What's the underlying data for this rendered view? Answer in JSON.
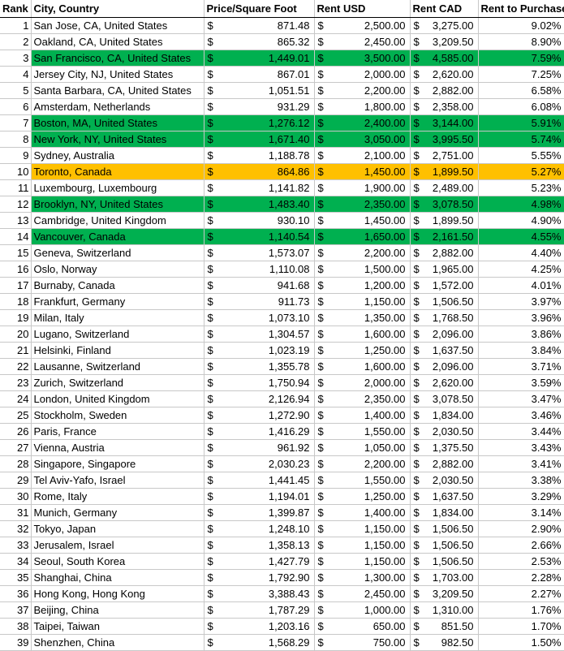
{
  "columns": {
    "rank": "Rank",
    "city": "City, Country",
    "price": "Price/Square Foot",
    "rent_usd": "Rent USD",
    "rent_cad": "Rent CAD",
    "rtp": "Rent to Purchase"
  },
  "currency_symbol": "$",
  "colors": {
    "green": "#00b050",
    "orange": "#ffc000"
  },
  "rows": [
    {
      "rank": "1",
      "city": "San Jose, CA, United States",
      "price": "871.48",
      "usd": "2,500.00",
      "cad": "3,275.00",
      "rtp": "9.02%",
      "hl": ""
    },
    {
      "rank": "2",
      "city": "Oakland, CA, United States",
      "price": "865.32",
      "usd": "2,450.00",
      "cad": "3,209.50",
      "rtp": "8.90%",
      "hl": ""
    },
    {
      "rank": "3",
      "city": "San Francisco, CA, United States",
      "price": "1,449.01",
      "usd": "3,500.00",
      "cad": "4,585.00",
      "rtp": "7.59%",
      "hl": "green"
    },
    {
      "rank": "4",
      "city": "Jersey City, NJ, United States",
      "price": "867.01",
      "usd": "2,000.00",
      "cad": "2,620.00",
      "rtp": "7.25%",
      "hl": ""
    },
    {
      "rank": "5",
      "city": "Santa Barbara, CA, United States",
      "price": "1,051.51",
      "usd": "2,200.00",
      "cad": "2,882.00",
      "rtp": "6.58%",
      "hl": ""
    },
    {
      "rank": "6",
      "city": "Amsterdam, Netherlands",
      "price": "931.29",
      "usd": "1,800.00",
      "cad": "2,358.00",
      "rtp": "6.08%",
      "hl": ""
    },
    {
      "rank": "7",
      "city": "Boston, MA, United States",
      "price": "1,276.12",
      "usd": "2,400.00",
      "cad": "3,144.00",
      "rtp": "5.91%",
      "hl": "green"
    },
    {
      "rank": "8",
      "city": "New York, NY, United States",
      "price": "1,671.40",
      "usd": "3,050.00",
      "cad": "3,995.50",
      "rtp": "5.74%",
      "hl": "green"
    },
    {
      "rank": "9",
      "city": "Sydney, Australia",
      "price": "1,188.78",
      "usd": "2,100.00",
      "cad": "2,751.00",
      "rtp": "5.55%",
      "hl": ""
    },
    {
      "rank": "10",
      "city": "Toronto, Canada",
      "price": "864.86",
      "usd": "1,450.00",
      "cad": "1,899.50",
      "rtp": "5.27%",
      "hl": "orange"
    },
    {
      "rank": "11",
      "city": "Luxembourg, Luxembourg",
      "price": "1,141.82",
      "usd": "1,900.00",
      "cad": "2,489.00",
      "rtp": "5.23%",
      "hl": ""
    },
    {
      "rank": "12",
      "city": "Brooklyn, NY, United States",
      "price": "1,483.40",
      "usd": "2,350.00",
      "cad": "3,078.50",
      "rtp": "4.98%",
      "hl": "green"
    },
    {
      "rank": "13",
      "city": "Cambridge, United Kingdom",
      "price": "930.10",
      "usd": "1,450.00",
      "cad": "1,899.50",
      "rtp": "4.90%",
      "hl": ""
    },
    {
      "rank": "14",
      "city": "Vancouver, Canada",
      "price": "1,140.54",
      "usd": "1,650.00",
      "cad": "2,161.50",
      "rtp": "4.55%",
      "hl": "green"
    },
    {
      "rank": "15",
      "city": "Geneva, Switzerland",
      "price": "1,573.07",
      "usd": "2,200.00",
      "cad": "2,882.00",
      "rtp": "4.40%",
      "hl": ""
    },
    {
      "rank": "16",
      "city": "Oslo, Norway",
      "price": "1,110.08",
      "usd": "1,500.00",
      "cad": "1,965.00",
      "rtp": "4.25%",
      "hl": ""
    },
    {
      "rank": "17",
      "city": "Burnaby, Canada",
      "price": "941.68",
      "usd": "1,200.00",
      "cad": "1,572.00",
      "rtp": "4.01%",
      "hl": ""
    },
    {
      "rank": "18",
      "city": "Frankfurt, Germany",
      "price": "911.73",
      "usd": "1,150.00",
      "cad": "1,506.50",
      "rtp": "3.97%",
      "hl": ""
    },
    {
      "rank": "19",
      "city": "Milan, Italy",
      "price": "1,073.10",
      "usd": "1,350.00",
      "cad": "1,768.50",
      "rtp": "3.96%",
      "hl": ""
    },
    {
      "rank": "20",
      "city": "Lugano, Switzerland",
      "price": "1,304.57",
      "usd": "1,600.00",
      "cad": "2,096.00",
      "rtp": "3.86%",
      "hl": ""
    },
    {
      "rank": "21",
      "city": "Helsinki, Finland",
      "price": "1,023.19",
      "usd": "1,250.00",
      "cad": "1,637.50",
      "rtp": "3.84%",
      "hl": ""
    },
    {
      "rank": "22",
      "city": "Lausanne, Switzerland",
      "price": "1,355.78",
      "usd": "1,600.00",
      "cad": "2,096.00",
      "rtp": "3.71%",
      "hl": ""
    },
    {
      "rank": "23",
      "city": "Zurich, Switzerland",
      "price": "1,750.94",
      "usd": "2,000.00",
      "cad": "2,620.00",
      "rtp": "3.59%",
      "hl": ""
    },
    {
      "rank": "24",
      "city": "London, United Kingdom",
      "price": "2,126.94",
      "usd": "2,350.00",
      "cad": "3,078.50",
      "rtp": "3.47%",
      "hl": ""
    },
    {
      "rank": "25",
      "city": "Stockholm, Sweden",
      "price": "1,272.90",
      "usd": "1,400.00",
      "cad": "1,834.00",
      "rtp": "3.46%",
      "hl": ""
    },
    {
      "rank": "26",
      "city": "Paris, France",
      "price": "1,416.29",
      "usd": "1,550.00",
      "cad": "2,030.50",
      "rtp": "3.44%",
      "hl": ""
    },
    {
      "rank": "27",
      "city": "Vienna, Austria",
      "price": "961.92",
      "usd": "1,050.00",
      "cad": "1,375.50",
      "rtp": "3.43%",
      "hl": ""
    },
    {
      "rank": "28",
      "city": "Singapore, Singapore",
      "price": "2,030.23",
      "usd": "2,200.00",
      "cad": "2,882.00",
      "rtp": "3.41%",
      "hl": ""
    },
    {
      "rank": "29",
      "city": "Tel Aviv-Yafo, Israel",
      "price": "1,441.45",
      "usd": "1,550.00",
      "cad": "2,030.50",
      "rtp": "3.38%",
      "hl": ""
    },
    {
      "rank": "30",
      "city": "Rome, Italy",
      "price": "1,194.01",
      "usd": "1,250.00",
      "cad": "1,637.50",
      "rtp": "3.29%",
      "hl": ""
    },
    {
      "rank": "31",
      "city": "Munich, Germany",
      "price": "1,399.87",
      "usd": "1,400.00",
      "cad": "1,834.00",
      "rtp": "3.14%",
      "hl": ""
    },
    {
      "rank": "32",
      "city": "Tokyo, Japan",
      "price": "1,248.10",
      "usd": "1,150.00",
      "cad": "1,506.50",
      "rtp": "2.90%",
      "hl": ""
    },
    {
      "rank": "33",
      "city": "Jerusalem, Israel",
      "price": "1,358.13",
      "usd": "1,150.00",
      "cad": "1,506.50",
      "rtp": "2.66%",
      "hl": ""
    },
    {
      "rank": "34",
      "city": "Seoul, South Korea",
      "price": "1,427.79",
      "usd": "1,150.00",
      "cad": "1,506.50",
      "rtp": "2.53%",
      "hl": ""
    },
    {
      "rank": "35",
      "city": "Shanghai, China",
      "price": "1,792.90",
      "usd": "1,300.00",
      "cad": "1,703.00",
      "rtp": "2.28%",
      "hl": ""
    },
    {
      "rank": "36",
      "city": "Hong Kong, Hong Kong",
      "price": "3,388.43",
      "usd": "2,450.00",
      "cad": "3,209.50",
      "rtp": "2.27%",
      "hl": ""
    },
    {
      "rank": "37",
      "city": "Beijing, China",
      "price": "1,787.29",
      "usd": "1,000.00",
      "cad": "1,310.00",
      "rtp": "1.76%",
      "hl": ""
    },
    {
      "rank": "38",
      "city": "Taipei, Taiwan",
      "price": "1,203.16",
      "usd": "650.00",
      "cad": "851.50",
      "rtp": "1.70%",
      "hl": ""
    },
    {
      "rank": "39",
      "city": "Shenzhen, China",
      "price": "1,568.29",
      "usd": "750.00",
      "cad": "982.50",
      "rtp": "1.50%",
      "hl": ""
    }
  ]
}
